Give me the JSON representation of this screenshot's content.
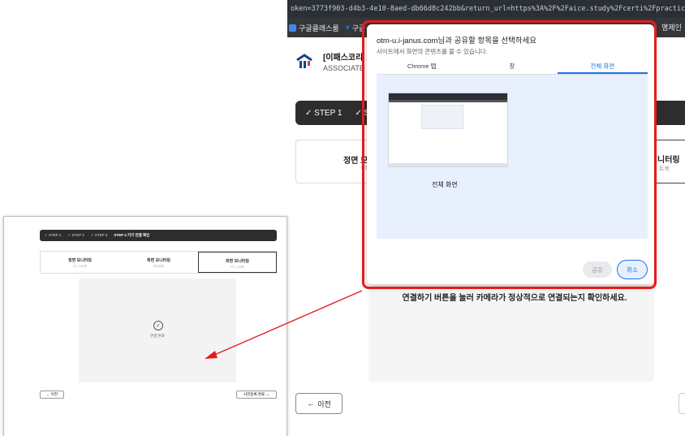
{
  "browser": {
    "url": "oken=3773f903-d4b3-4e10-8aed-db66d8c242bb&return_url=https%3A%2F%2Faice.study%2Fcerti%2Fpractice",
    "bookmarks": [
      "구글클래스룸",
      "구글"
    ],
    "bookmark_right": "명제인"
  },
  "site": {
    "title": "[이패스코리",
    "subtitle": "ASSOCIATE"
  },
  "steps": [
    "✓ STEP 1",
    "✓ S"
  ],
  "cards": {
    "left_title": "정면 모",
    "left_sub": "PC",
    "right_title": "니터링",
    "right_sub": "트북"
  },
  "area_message": "연결하기 버튼을 눌러 카메라가 정상적으로 연결되는지 확인하세요.",
  "prev_button": "이전",
  "dialog": {
    "title": "otm-u.i-janus.com님과 공유할 항목을 선택하세요",
    "subtitle": "사이트에서 화면의 콘텐츠를 볼 수 있습니다.",
    "tabs": [
      "Chrome 탭",
      "창",
      "전체 화면"
    ],
    "active_tab": 2,
    "thumbnail_label": "전체 화면",
    "share_label": "공유",
    "cancel_label": "취소",
    "highlight_color": "#e51c1c",
    "accent_color": "#1a73e8"
  },
  "inset": {
    "steps": [
      "✓ STEP 1",
      "✓ STEP 2",
      "✓ STEP 3",
      "STEP 4 기기 연결 확인"
    ],
    "cards": [
      {
        "title": "정면 모니터링",
        "sub": "PC, 노트북"
      },
      {
        "title": "측면 모니터링",
        "sub": "휴대전화"
      },
      {
        "title": "화면 모니터링",
        "sub": "PC, 노트북"
      }
    ],
    "done_label": "연결 완료",
    "prev_label": "← 이전",
    "next_label": "사전등록 완료 →"
  }
}
